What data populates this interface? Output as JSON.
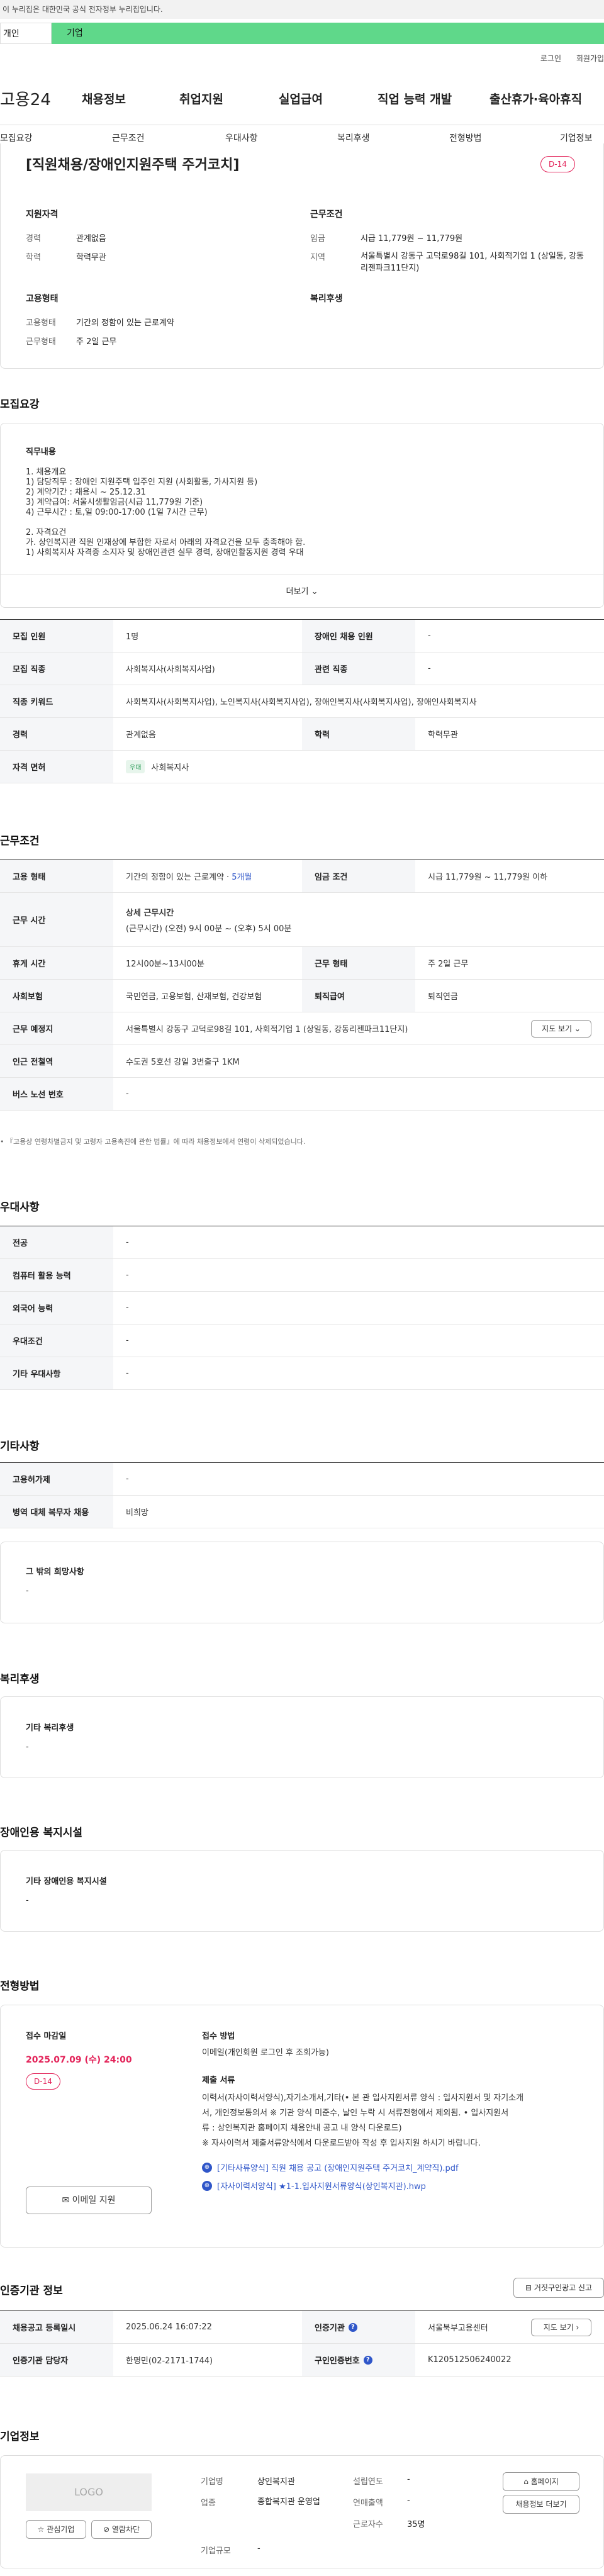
{
  "gov_banner": "이 누리집은 대한민국 공식 전자정부 누리집입니다.",
  "tabs": [
    "개인",
    "기업"
  ],
  "util": [
    "로그인",
    "회원가입"
  ],
  "logo": "고용24",
  "gnb": [
    "채용정보",
    "취업지원",
    "실업급여",
    "직업 능력 개발",
    "출산휴가·육아휴직"
  ],
  "subnav": [
    "모집요강",
    "근무조건",
    "우대사항",
    "복리후생",
    "전형방법",
    "기업정보"
  ],
  "title": "[직원채용/장애인지원주택 주거코치]",
  "dday": "D-14",
  "summary": {
    "qual_title": "지원자격",
    "cond_title": "근무조건",
    "career_lbl": "경력",
    "career": "관계없음",
    "edu_lbl": "학력",
    "edu": "학력무관",
    "wage_lbl": "임금",
    "wage": "시급 11,779원 ~ 11,779원",
    "area_lbl": "지역",
    "area": "서울특별시 강동구 고덕로98길 101, 사회적기업 1 (상일동, 강동리젠파크11단지)",
    "emp_title": "고용형태",
    "welfare_title": "복리후생",
    "type_lbl": "고용형태",
    "type": "기간의 정함이 있는 근로계약",
    "work_lbl": "근무형태",
    "work": "주 2일 근무"
  },
  "recruit": {
    "title": "모집요강",
    "duty_title": "직무내용",
    "lines": [
      "1. 채용개요",
      "1) 담당직무 : 장애인 지원주택 입주인 지원 (사회활동, 가사지원 등)",
      "2) 계약기간 : 채용시 ~ 25.12.31",
      "3) 계약급여: 서울시생활임금(시급 11,779원 기준)",
      "4) 근무시간 : 토,일 09:00-17:00 (1일 7시간 근무)",
      "",
      "2. 자격요건",
      "가. 상인복지관 직원 인재상에 부합한 자로서 아래의 자격요건을 모두 충족해야 함.",
      "1) 사회복지사 자격증 소지자 및 장애인관련 실무 경력, 장애인활동지원 경력 우대"
    ],
    "more": "더보기",
    "rows": [
      {
        "th": "모집 인원",
        "td": "1명",
        "th2": "장애인 채용 인원",
        "td2": "-"
      },
      {
        "th": "모집 직종",
        "td": "사회복지사(사회복지사업)",
        "th2": "관련 직종",
        "td2": "-"
      },
      {
        "th": "직종 키워드",
        "td": "사회복지사(사회복지사업), 노인복지사(사회복지사업), 장애인복지사(사회복지사업), 장애인사회복지사"
      },
      {
        "th": "경력",
        "td": "관계없음",
        "th2": "학력",
        "td2": "학력무관"
      },
      {
        "th": "자격 면허",
        "badge": "우대",
        "td": "사회복지사"
      }
    ]
  },
  "cond": {
    "title": "근무조건",
    "r1_th": "고용 형태",
    "r1_td": "기간의 정함이 있는 근로계약 · ",
    "r1_td_blue": "5개월",
    "r1_th2": "임금 조건",
    "r1_td2": "시급 11,779원 ~ 11,779원 이하",
    "r2_th": "근무 시간",
    "r2_a": "상세 근무시간",
    "r2_b": "(근무시간) (오전) 9시 00분 ~ (오후) 5시 00분",
    "r3_th": "휴게 시간",
    "r3_td": "12시00분~13시00분",
    "r3_th2": "근무 형태",
    "r3_td2": "주 2일 근무",
    "r4_th": "사회보험",
    "r4_td": "국민연금, 고용보험, 산재보험, 건강보험",
    "r4_th2": "퇴직급여",
    "r4_td2": "퇴직연금",
    "r5_th": "근무 예정지",
    "r5_td": "서울특별시 강동구 고덕로98길 101, 사회적기업 1 (상일동, 강동리젠파크11단지)",
    "map_btn": "지도 보기",
    "r6_th": "인근 전철역",
    "r6_td": "수도권 5호선 강일 3번출구 1KM",
    "r7_th": "버스 노선 번호",
    "r7_td": "-",
    "notice": "『고용상 연령차별금지 및 고령자 고용촉진에 관한 법률』에 따라 채용정보에서 연령이 삭제되었습니다."
  },
  "pref": {
    "title": "우대사항",
    "rows": [
      {
        "th": "전공",
        "td": "-"
      },
      {
        "th": "컴퓨터 활용 능력",
        "td": "-"
      },
      {
        "th": "외국어 능력",
        "td": "-"
      },
      {
        "th": "우대조건",
        "td": "-"
      },
      {
        "th": "기타 우대사항",
        "td": "-"
      }
    ]
  },
  "etc": {
    "title": "기타사항",
    "rows": [
      {
        "th": "고용허가제",
        "td": "-"
      },
      {
        "th": "병역 대체 복무자 채용",
        "td": "비희망"
      }
    ],
    "box_title": "그 밖의 희망사항",
    "box_td": "-"
  },
  "welfare": {
    "title": "복리후생",
    "box_title": "기타 복리후생",
    "box_td": "-"
  },
  "facility": {
    "title": "장애인용 복지시설",
    "box_title": "기타 장애인용 복지시설",
    "box_td": "-"
  },
  "apply": {
    "title": "전형방법",
    "deadline_lbl": "접수 마감일",
    "deadline": "2025.07.09 (수) 24:00",
    "dday": "D-14",
    "email_btn": "이메일 지원",
    "method_lbl": "접수 방법",
    "method": "이메일(개인회원 로그인 후 조회가능)",
    "docs_lbl": "제출 서류",
    "docs": [
      "이력서(자사이력서양식),자기소개서,기타(• 본 관 입사지원서류 양식 : 입사지원서 및 자기소개",
      "서, 개인정보동의서 ※ 기관 양식 미준수, 날인 누락 시 서류전형에서 제외됨. • 입사지원서",
      "류 : 상인복지관 홈페이지 채용안내 공고 내 양식 다운로드)",
      "※ 자사이력서 제출서류양식에서 다운로드받아 작성 후 입사지원 하시기 바랍니다."
    ],
    "file1": "[기타사류양식] 직원 채용 공고 (장애인지원주택 주거코치_계약직).pdf",
    "file2": "[자사이력서양식] ★1-1.입사지원서류양식(상인복지관).hwp"
  },
  "cert": {
    "title": "인증기관 정보",
    "btn": "거짓구인광고 신고",
    "r1_th": "채용공고 등록일시",
    "r1_td": "2025.06.24 16:07:22",
    "r1_th2": "인증기관",
    "r1_td2": "서울북부고용센터",
    "map_btn": "지도 보기",
    "r2_th": "인증기관 담당자",
    "r2_td": "한명민(02-2171-1744)",
    "r2_th2": "구인인증번호",
    "r2_td2": "K120512506240022"
  },
  "company": {
    "title": "기업정보",
    "logo": "LOGO",
    "fav_btn": "관심기업",
    "block_btn": "열람차단",
    "name_lbl": "기업명",
    "name": "상인복지관",
    "ind_lbl": "업종",
    "ind": "종합복지관 운영업",
    "size_lbl": "기업규모",
    "size": "-",
    "year_lbl": "설립연도",
    "year": "-",
    "sales_lbl": "연매출액",
    "sales": "-",
    "emp_lbl": "근로자수",
    "emp": "35명",
    "home_btn": "홈페이지",
    "jobs_btn": "채용정보 더보기"
  }
}
